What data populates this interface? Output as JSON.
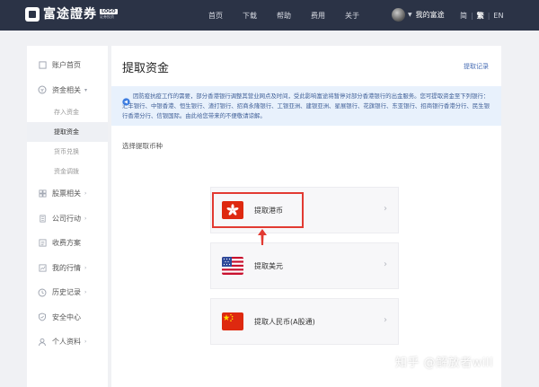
{
  "brand": {
    "name": "富途證券",
    "badge": "LOGO",
    "badge_sub": "证券投资"
  },
  "nav": [
    "首页",
    "下载",
    "帮助",
    "费用",
    "关于"
  ],
  "user": {
    "label": "我的富途"
  },
  "langs": {
    "simplified": "简",
    "traditional": "繁",
    "english": "EN"
  },
  "sidebar": {
    "account_home": "账户首页",
    "funds": "资金相关",
    "funds_sub": [
      "存入资金",
      "提取资金",
      "货币兑换",
      "资金调拨"
    ],
    "stocks": "股票相关",
    "corporate": "公司行动",
    "fees": "收费方案",
    "quotes": "我的行情",
    "history": "历史记录",
    "security": "安全中心",
    "profile": "个人资料"
  },
  "main": {
    "title": "提取资金",
    "record_link": "提取记录",
    "notice": "因防疫抗疫工作的需要，部分香港银行调整其营业网点及时间，受此影响富途将暂停对部分香港银行的出金服务。您可提取资金至下列银行：汇丰银行、中银香港、恒生银行、渣打银行、招商永隆银行、工银亚洲、建银亚洲、星展银行、花旗银行、东亚银行、招商银行香港分行、民生银行香港分行、信银国际。由此给您带来的不便敬请谅解。",
    "subhead": "选择提取币种",
    "currencies": [
      {
        "label": "提取港币",
        "flag": "hong-kong"
      },
      {
        "label": "提取美元",
        "flag": "united-states"
      },
      {
        "label": "提取人民币(A股通)",
        "flag": "china"
      }
    ]
  },
  "watermark": "知乎 @解放者will",
  "colors": {
    "topbar": "#2b3346",
    "highlight": "#e23a32",
    "link": "#4a6fb5",
    "notice_bg": "#e8f1fc"
  }
}
